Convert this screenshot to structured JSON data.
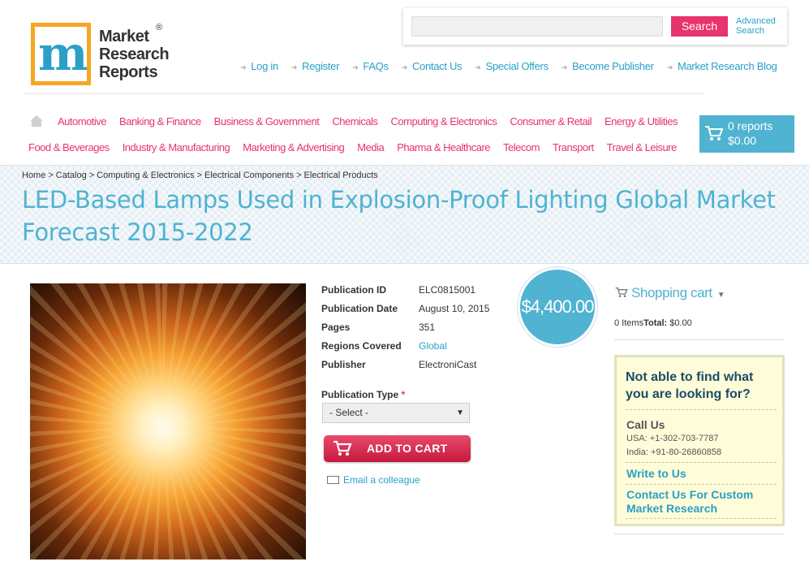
{
  "logo": {
    "line1": "Market",
    "line2": "Research",
    "line3": "Reports",
    "reg": "®",
    "mark": "m"
  },
  "search": {
    "placeholder": "",
    "button": "Search",
    "advanced": "Advanced Search"
  },
  "top_links": [
    "Log in",
    "Register",
    "FAQs",
    "Contact Us",
    "Special Offers",
    "Become Publisher",
    "Market Research Blog"
  ],
  "categories_row1": [
    "Automotive",
    "Banking & Finance",
    "Business & Government",
    "Chemicals",
    "Computing & Electronics",
    "Consumer & Retail",
    "Energy & Utilities"
  ],
  "categories_row2": [
    "Food & Beverages",
    "Industry & Manufacturing",
    "Marketing & Advertising",
    "Media",
    "Pharma & Healthcare",
    "Telecom",
    "Transport",
    "Travel & Leisure"
  ],
  "cart": {
    "reports": "0 reports",
    "total": "$0.00"
  },
  "breadcrumb": [
    "Home",
    "Catalog",
    "Computing & Electronics",
    "Electrical Components",
    "Electrical Products"
  ],
  "title": "LED-Based Lamps Used in Explosion-Proof Lighting Global Market Forecast 2015-2022",
  "details": [
    {
      "label": "Publication ID",
      "value": "ELC0815001"
    },
    {
      "label": "Publication Date",
      "value": "August 10, 2015"
    },
    {
      "label": "Pages",
      "value": "351"
    },
    {
      "label": "Regions Covered",
      "value": "Global"
    },
    {
      "label": "Publisher",
      "value": "ElectroniCast"
    }
  ],
  "price": "$4,400.00",
  "publication_type": {
    "label": "Publication Type",
    "required": "*",
    "selected": "- Select -"
  },
  "add_to_cart": "ADD TO CART",
  "email_colleague": "Email a colleague",
  "shopping_cart": {
    "title": "Shopping cart",
    "items_label": "0 Items",
    "total_label": "Total:",
    "total_value": "$0.00"
  },
  "help": {
    "heading": "Not able to find what you are looking for?",
    "call_us": "Call Us",
    "usa": "USA: +1-302-703-7787",
    "india": "India: +91-80-26860858",
    "write_to_us": "Write to Us",
    "custom_research": "Contact Us For Custom Market Research"
  },
  "colors": {
    "accent_blue": "#4fb3d1",
    "accent_pink": "#e8336d",
    "logo_orange": "#f5a623"
  },
  "icons": [
    "home-icon",
    "cart-icon",
    "envelope-icon",
    "caret-down-icon",
    "arrow-bullet-icon"
  ]
}
